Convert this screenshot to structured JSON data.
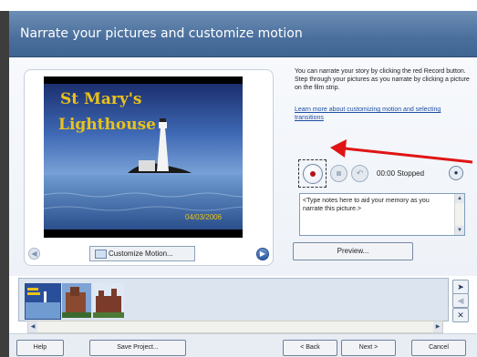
{
  "window": {
    "title": "Narrate your pictures and customize motion"
  },
  "photo": {
    "title_line1": "St Mary's",
    "title_line2": "Lighthouse",
    "date": "04/03/2006"
  },
  "controls": {
    "customize_motion_label": "Customize Motion...",
    "preview_label": "Preview...",
    "timer": "00:00  Stopped"
  },
  "info": {
    "text": "You can narrate your story by clicking the red Record button. Step through your pictures as you narrate by clicking a picture on the film strip.",
    "link": "Learn more about customizing motion and selecting transitions"
  },
  "notes": {
    "value": "<Type notes here to aid your memory as you narrate this picture.>"
  },
  "footer": {
    "help": "Help",
    "save": "Save Project...",
    "back": "< Back",
    "next": "Next >",
    "cancel": "Cancel"
  },
  "colors": {
    "accent": "#4a6f9c",
    "record": "#b5121b",
    "arrow": "#e01414"
  },
  "icons": [
    "record-icon",
    "stop-icon",
    "undo-icon",
    "microphone-icon",
    "arrow-right-icon",
    "arrow-left-icon",
    "close-icon",
    "prev-icon",
    "next-icon"
  ]
}
